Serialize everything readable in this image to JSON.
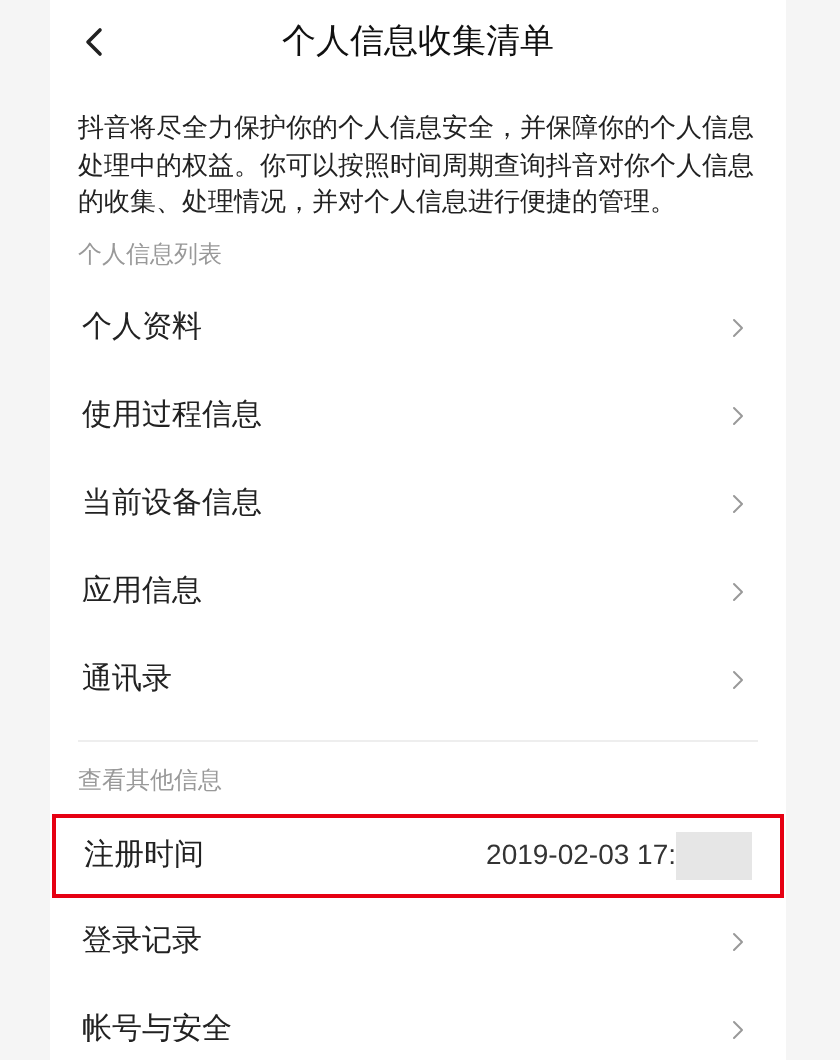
{
  "header": {
    "title": "个人信息收集清单"
  },
  "intro": "抖音将尽全力保护你的个人信息安全，并保障你的个人信息处理中的权益。你可以按照时间周期查询抖音对你个人信息的收集、处理情况，并对个人信息进行便捷的管理。",
  "sections": [
    {
      "label": "个人信息列表",
      "items": [
        {
          "kind": "link",
          "label": "个人资料",
          "highlighted": false
        },
        {
          "kind": "link",
          "label": "使用过程信息",
          "highlighted": false
        },
        {
          "kind": "link",
          "label": "当前设备信息",
          "highlighted": false
        },
        {
          "kind": "link",
          "label": "应用信息",
          "highlighted": false
        },
        {
          "kind": "link",
          "label": "通讯录",
          "highlighted": false
        }
      ]
    },
    {
      "label": "查看其他信息",
      "items": [
        {
          "kind": "value",
          "label": "注册时间",
          "value": "2019-02-03 17:",
          "redacted": true,
          "highlighted": true
        },
        {
          "kind": "link",
          "label": "登录记录",
          "highlighted": false
        },
        {
          "kind": "link",
          "label": "帐号与安全",
          "highlighted": false
        }
      ]
    }
  ]
}
